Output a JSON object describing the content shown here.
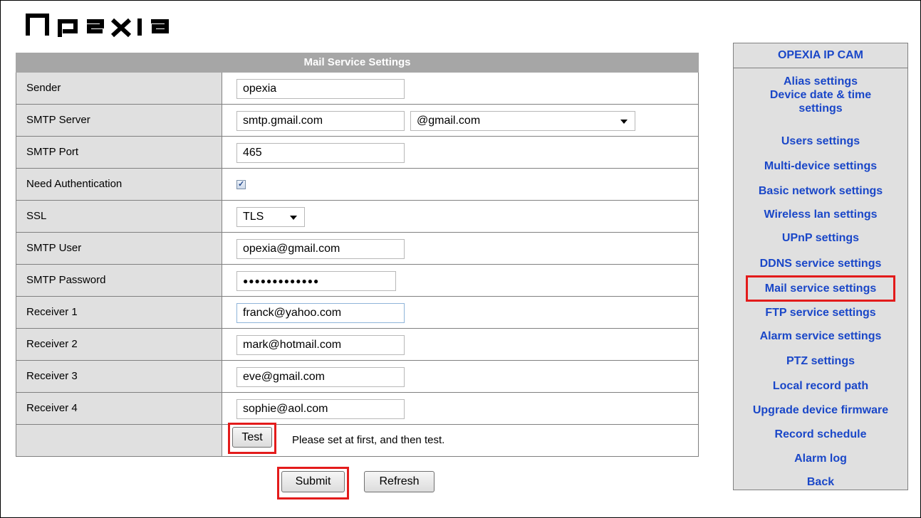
{
  "brand": {
    "logo_text": "opexia",
    "logo_color": "#000000"
  },
  "header": {
    "title": "Mail Service Settings"
  },
  "form": {
    "sender": {
      "label": "Sender",
      "value": "opexia"
    },
    "smtp_server": {
      "label": "SMTP Server",
      "value": "smtp.gmail.com",
      "preset": "@gmail.com"
    },
    "smtp_port": {
      "label": "SMTP Port",
      "value": "465"
    },
    "need_auth": {
      "label": "Need Authentication",
      "checked": true
    },
    "ssl": {
      "label": "SSL",
      "value": "TLS"
    },
    "smtp_user": {
      "label": "SMTP User",
      "value": "opexia@gmail.com"
    },
    "smtp_password": {
      "label": "SMTP Password",
      "value": "●●●●●●●●●●●●●"
    },
    "receiver1": {
      "label": "Receiver 1",
      "value": "franck@yahoo.com"
    },
    "receiver2": {
      "label": "Receiver 2",
      "value": "mark@hotmail.com"
    },
    "receiver3": {
      "label": "Receiver 3",
      "value": "eve@gmail.com"
    },
    "receiver4": {
      "label": "Receiver 4",
      "value": "sophie@aol.com"
    },
    "test_label": "Test",
    "test_hint": "Please set at first, and then test."
  },
  "actions": {
    "submit": "Submit",
    "refresh": "Refresh"
  },
  "nav": {
    "title": "OPEXIA IP CAM",
    "items": [
      "Alias settings",
      "Device date & time settings",
      "Users settings",
      "Multi-device settings",
      "Basic network settings",
      "Wireless lan settings",
      "UPnP settings",
      "DDNS service settings",
      "Mail service settings",
      "FTP service settings",
      "Alarm service settings",
      "PTZ settings",
      "Local record path",
      "Upgrade device firmware",
      "Record schedule",
      "Alarm log",
      "Back"
    ],
    "active": "Mail service settings"
  },
  "colors": {
    "nav_link": "#1a47c8",
    "highlight": "#e31b1b",
    "header_bg": "#a6a6a6",
    "label_bg": "#e0e0e0"
  }
}
